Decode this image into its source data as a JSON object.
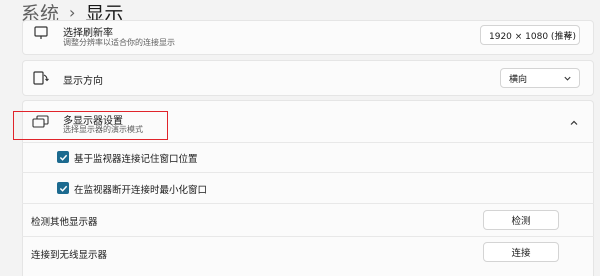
{
  "breadcrumb": {
    "parent": "系统",
    "separator": "›",
    "current": "显示"
  },
  "refresh_rate": {
    "title": "选择刷新率",
    "subtitle": "调整分辨率以适合你的连接显示",
    "value": "1920 × 1080 (推荐)",
    "icon": "refresh-rate-icon"
  },
  "orientation": {
    "title": "显示方向",
    "value": "横向",
    "icon": "rotate-display-icon"
  },
  "multiple_displays": {
    "title": "多显示器设置",
    "subtitle": "选择显示器的演示模式",
    "icon": "multiple-displays-icon",
    "expanded": true,
    "options": [
      {
        "label": "基于监视器连接记住窗口位置",
        "checked": true
      },
      {
        "label": "在监视器断开连接时最小化窗口",
        "checked": true
      }
    ],
    "detect": {
      "label": "检测其他显示器",
      "button": "检测"
    },
    "wireless": {
      "label": "连接到无线显示器",
      "button": "连接"
    }
  },
  "colors": {
    "checkbox": "#1c6a8f",
    "highlight": "#e0242b"
  }
}
